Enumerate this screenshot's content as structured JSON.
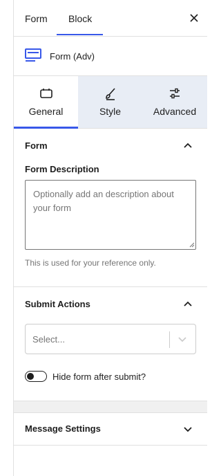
{
  "top_tabs": {
    "form": "Form",
    "block": "Block"
  },
  "block": {
    "title": "Form (Adv)",
    "icon": "form-block-icon"
  },
  "settings_tabs": [
    {
      "label": "General",
      "icon": "general-icon",
      "active": true
    },
    {
      "label": "Style",
      "icon": "brush-icon",
      "active": false
    },
    {
      "label": "Advanced",
      "icon": "sliders-icon",
      "active": false
    }
  ],
  "form_section": {
    "title": "Form",
    "description_label": "Form Description",
    "description_placeholder": "Optionally add an description about your form",
    "description_value": "",
    "help": "This is used for your reference only."
  },
  "submit_section": {
    "title": "Submit Actions",
    "select_placeholder": "Select...",
    "toggle_label": "Hide form after submit?",
    "toggle_on": false
  },
  "message_section": {
    "title": "Message Settings"
  },
  "colors": {
    "accent": "#3858e9",
    "tab_inactive_bg": "#e8edf5",
    "text": "#1e1e1e",
    "muted": "#757575"
  }
}
